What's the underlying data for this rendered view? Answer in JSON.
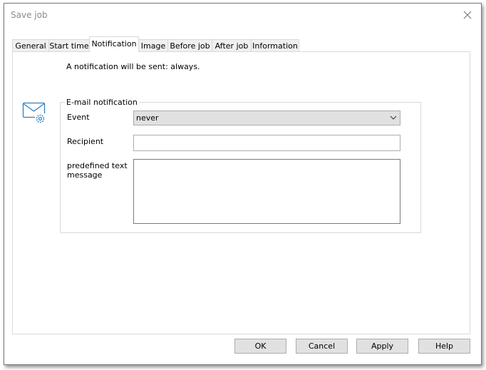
{
  "window": {
    "title": "Save job",
    "close_icon": "close-icon"
  },
  "tabs": [
    {
      "label": "General",
      "selected": false
    },
    {
      "label": "Start time",
      "selected": false
    },
    {
      "label": "Notification",
      "selected": true
    },
    {
      "label": "Image",
      "selected": false
    },
    {
      "label": "Before job",
      "selected": false
    },
    {
      "label": "After job",
      "selected": false
    },
    {
      "label": "Information",
      "selected": false
    }
  ],
  "notification": {
    "info_text": "A notification will be sent: always.",
    "icon": "mail-settings-icon",
    "group_title": "E-mail notification",
    "event_label": "Event",
    "event_value": "never",
    "recipient_label": "Recipient",
    "recipient_value": "",
    "message_label_line1": "predefined text",
    "message_label_line2": "message",
    "message_value": ""
  },
  "buttons": {
    "ok": "OK",
    "cancel": "Cancel",
    "apply": "Apply",
    "help": "Help"
  },
  "colors": {
    "icon_blue": "#2f7fc8",
    "button_bg": "#e1e1e1"
  }
}
